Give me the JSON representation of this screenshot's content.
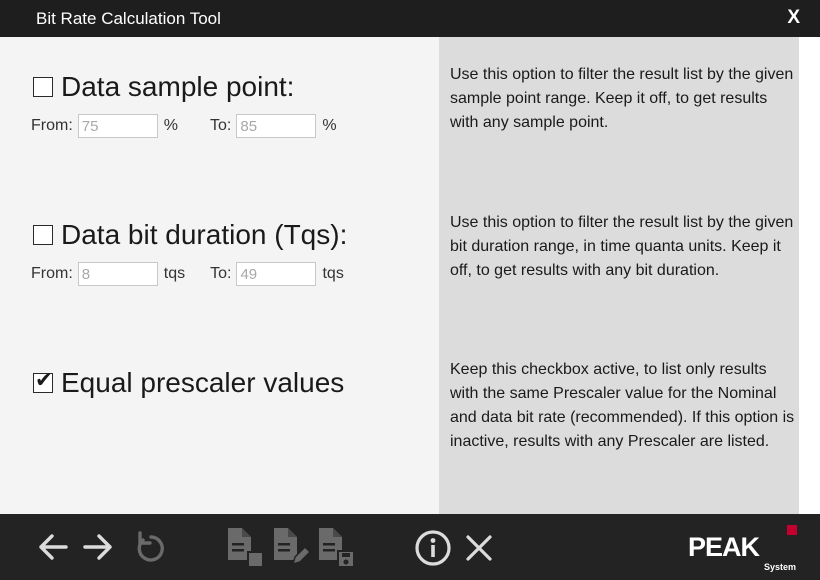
{
  "window": {
    "title": "Bit Rate Calculation Tool",
    "close_label": "X"
  },
  "sample_point": {
    "label": "Data sample point:",
    "checked": false,
    "from_label": "From:",
    "from_value": "75",
    "from_unit": "%",
    "to_label": "To:",
    "to_value": "85",
    "to_unit": "%",
    "description": "Use this option to filter the result list by the given sample point range. Keep it off, to get results with any sample point."
  },
  "bit_duration": {
    "label": "Data bit duration (Tqs):",
    "checked": false,
    "from_label": "From:",
    "from_value": "8",
    "from_unit": "tqs",
    "to_label": "To:",
    "to_value": "49",
    "to_unit": "tqs",
    "description": "Use this option to filter the result list by the given bit duration range, in time quanta units. Keep it off, to get results with any bit duration."
  },
  "prescaler": {
    "label": "Equal prescaler values",
    "checked": true,
    "check_glyph": "✔",
    "description": "Keep this checkbox active, to list only results with the same Prescaler value for the Nominal and data bit rate (recommended). If this option is inactive, results with any Prescaler are listed."
  },
  "toolbar": {
    "icons": [
      "back-arrow-icon",
      "forward-arrow-icon",
      "reset-icon",
      "new-document-icon",
      "edit-document-icon",
      "save-document-icon",
      "info-icon",
      "close-icon"
    ]
  },
  "logo": {
    "text": "PEAK",
    "subtext": "System",
    "accent_color": "#c3002f"
  },
  "colors": {
    "titlebar": "#1e1e1e",
    "toolbar": "#232323",
    "description_panel": "#dcdcdc",
    "main_background": "#f4f4f4"
  }
}
